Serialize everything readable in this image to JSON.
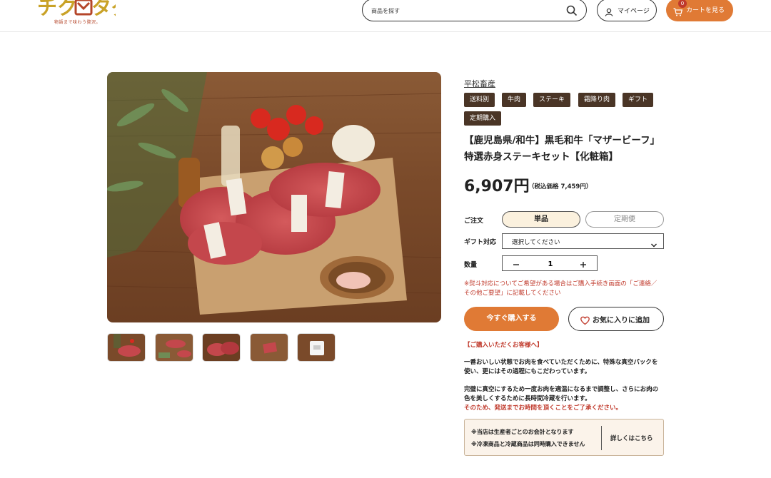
{
  "header": {
    "logo_text": "チクビタグ",
    "logo_sub": "物語まで味わう贅沢。",
    "search_placeholder": "商品を探す",
    "mypage_label": "マイページ",
    "cart_label": "カートを見る",
    "cart_count": "0"
  },
  "product": {
    "producer": "平松畜産",
    "tags": [
      "送料別",
      "牛肉",
      "ステーキ",
      "霜降り肉",
      "ギフト",
      "定期購入"
    ],
    "title_line1": "【鹿児島県/和牛】黒毛和牛「マザービーフ」",
    "title_line2": "特選赤身ステーキセット【化粧箱】",
    "price": "6,907円",
    "price_tax": "（税込価格 7,459円）",
    "images_count": 5
  },
  "order_form": {
    "order_label": "ご注文",
    "option_single": "単品",
    "option_subscription": "定期便",
    "selected_option": "単品",
    "gift_label": "ギフト対応",
    "gift_value": "選択してください",
    "qty_label": "数量",
    "qty_value": "1",
    "note_line1": "※熨斗対応についてご希望がある場合はご購入手続き画面の「ご連絡／",
    "note_line2": "その他ご要望」に記載してください",
    "buy_label": "今すぐ購入する",
    "fav_label": "お気に入りに追加"
  },
  "buyer_info": {
    "heading": "【ご購入いただくお客様へ】",
    "p1_line1": "一番おいしい状態でお肉を食べていただくために、特殊な真空パックを",
    "p1_line2": "使い、更にはその過程にもこだわっています。",
    "p2_line1": "完璧に真空にするため一度お肉を適温になるまで調整し、さらにお肉の",
    "p2_line2": "色を美しくするために長時間冷蔵を行います。",
    "p2_red": "そのため、発送までお時間を頂くことをご了承ください。"
  },
  "notice": {
    "line1": "※当店は生産者ごとのお会計となります",
    "line2": "※冷凍商品と冷蔵商品は同時購入できません",
    "detail_link": "詳しくはこちら"
  },
  "colors": {
    "accent_orange": "#e07a35",
    "tag_brown": "#4a3526",
    "note_red": "#c0392b",
    "logo_red": "#b5462a",
    "logo_gold": "#c9a227"
  }
}
